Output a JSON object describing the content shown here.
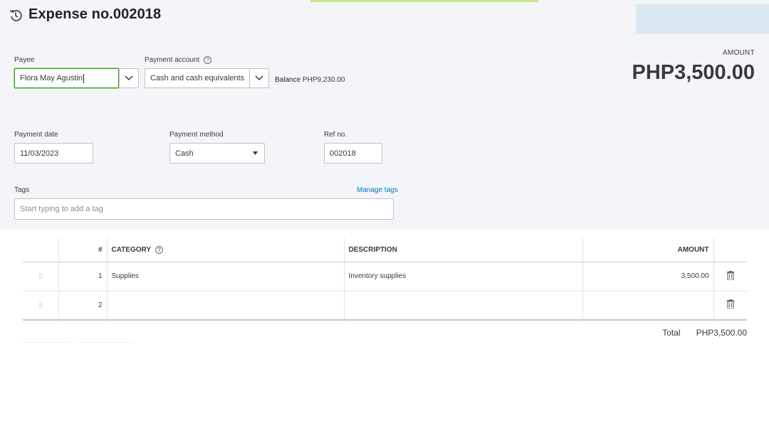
{
  "header": {
    "title": "Expense no.002018"
  },
  "payee": {
    "label": "Payee",
    "value": "Flora May Agustin"
  },
  "payment_account": {
    "label": "Payment account",
    "value": "Cash and cash equivalents",
    "balance_label": "Balance",
    "balance_value": "PHP9,230.00"
  },
  "amount": {
    "label": "AMOUNT",
    "value": "PHP3,500.00"
  },
  "payment_date": {
    "label": "Payment date",
    "value": "11/03/2023"
  },
  "payment_method": {
    "label": "Payment method",
    "value": "Cash"
  },
  "ref_no": {
    "label": "Ref no.",
    "value": "002018"
  },
  "tags": {
    "label": "Tags",
    "manage_link": "Manage tags",
    "placeholder": "Start typing to add a tag"
  },
  "table": {
    "headers": {
      "num": "#",
      "category": "CATEGORY",
      "description": "DESCRIPTION",
      "amount": "AMOUNT"
    },
    "rows": [
      {
        "num": "1",
        "category": "Supplies",
        "description": "Inventory supplies",
        "amount": "3,500.00"
      },
      {
        "num": "2",
        "category": "",
        "description": "",
        "amount": ""
      }
    ]
  },
  "total": {
    "label": "Total",
    "value": "PHP3,500.00"
  },
  "colors": {
    "accent_green": "#2ca01c",
    "link_blue": "#0077c5",
    "background": "#f4f5f8"
  }
}
